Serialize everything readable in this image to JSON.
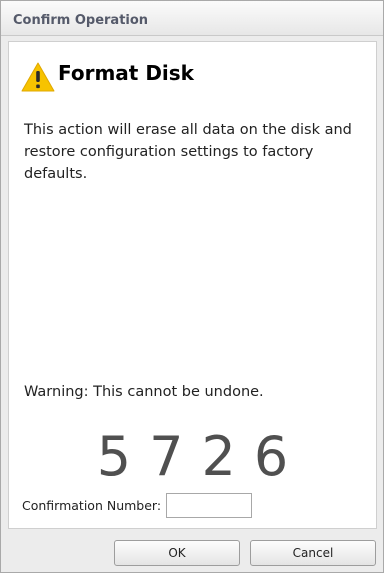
{
  "dialog": {
    "title": "Confirm Operation",
    "heading": "Format Disk",
    "heading_icon": "warning-triangle-icon",
    "message": "This action will erase all data on the disk and restore configuration settings to factory defaults.",
    "warning": "Warning: This cannot be undone.",
    "confirmation_code": "5726",
    "confirmation_label": "Confirmation Number:",
    "confirmation_value": "",
    "buttons": {
      "ok_label": "OK",
      "cancel_label": "Cancel"
    },
    "colors": {
      "title_text": "#555a6a",
      "icon_yellow": "#f7c300",
      "code_text": "#505050"
    }
  }
}
